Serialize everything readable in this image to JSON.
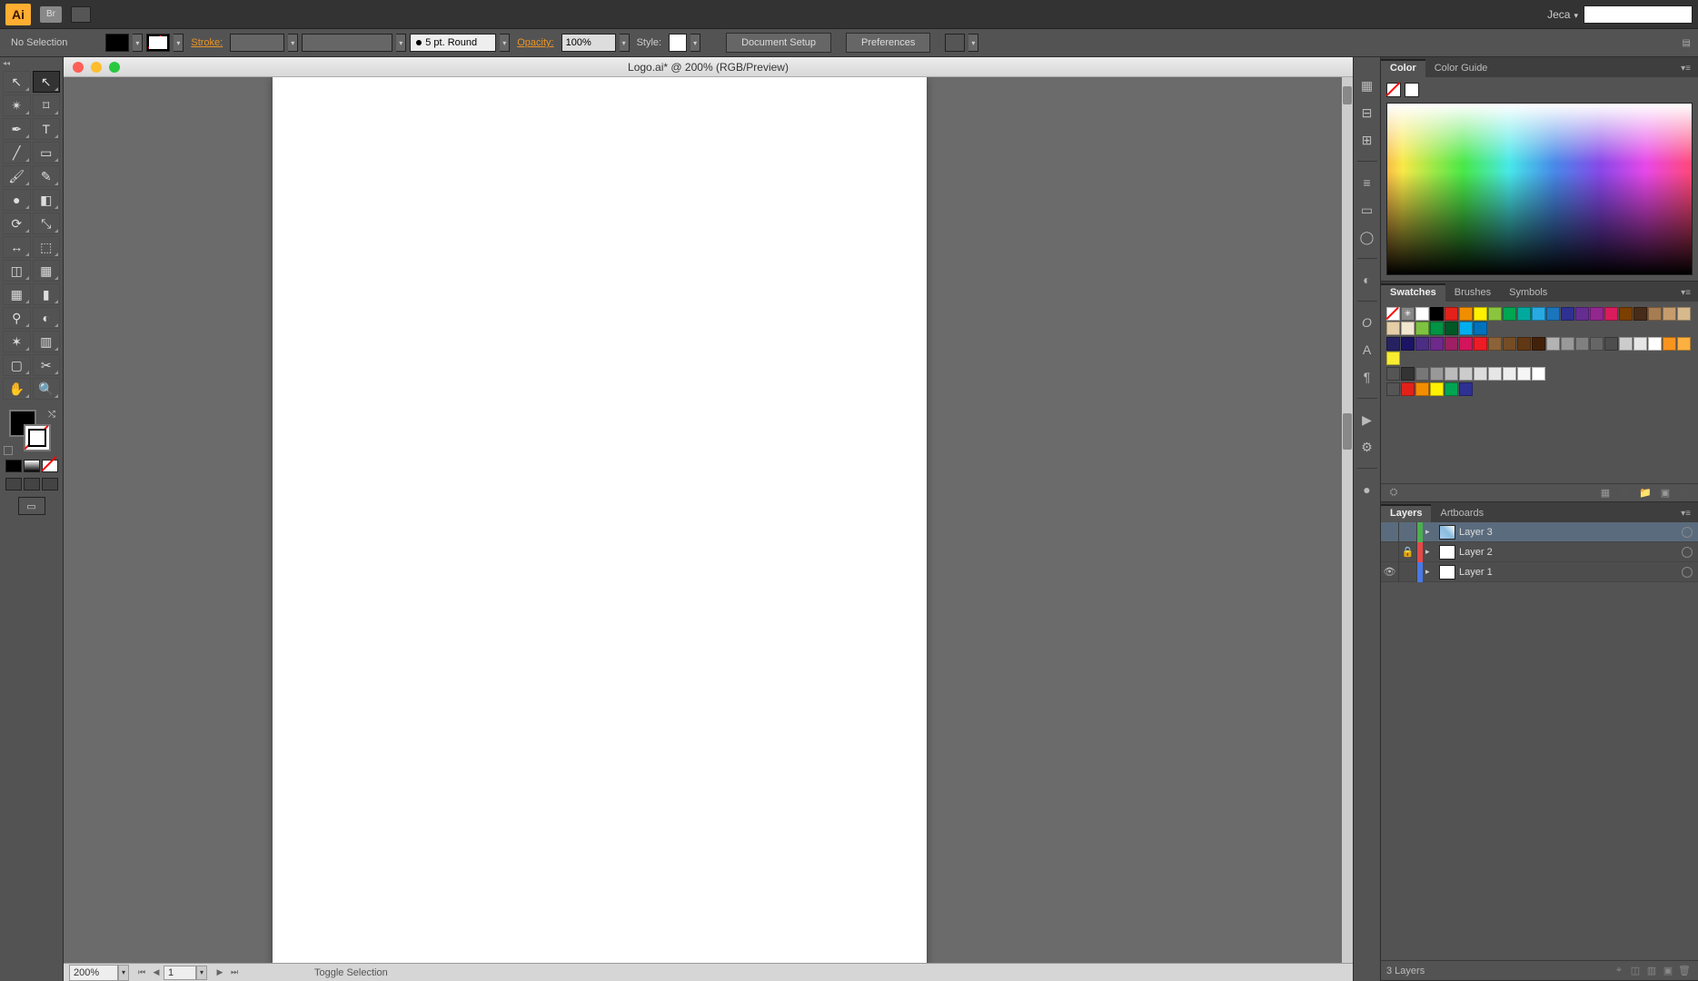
{
  "appbar": {
    "logo": "Ai",
    "bridge": "Br",
    "user": "Jeca"
  },
  "controlbar": {
    "selection": "No Selection",
    "stroke_label": "Stroke:",
    "brush_text": "5 pt. Round",
    "opacity_label": "Opacity:",
    "opacity_value": "100%",
    "style_label": "Style:",
    "doc_setup": "Document Setup",
    "preferences": "Preferences"
  },
  "document": {
    "title": "Logo.ai* @ 200% (RGB/Preview)"
  },
  "panels": {
    "color": {
      "tab1": "Color",
      "tab2": "Color Guide"
    },
    "swatches": {
      "tab1": "Swatches",
      "tab2": "Brushes",
      "tab3": "Symbols"
    },
    "layers": {
      "tab1": "Layers",
      "tab2": "Artboards",
      "items": [
        {
          "name": "Layer 3",
          "color": "green",
          "selected": true,
          "visible": false,
          "locked": false,
          "thumb": "img"
        },
        {
          "name": "Layer 2",
          "color": "red",
          "selected": false,
          "visible": false,
          "locked": true,
          "thumb": "white"
        },
        {
          "name": "Layer 1",
          "color": "blue",
          "selected": false,
          "visible": true,
          "locked": false,
          "thumb": "white"
        }
      ],
      "footer_count": "3 Layers"
    }
  },
  "swatch_colors": {
    "row1": [
      "#ffffff",
      "#000000",
      "#e32119",
      "#f18e00",
      "#fff100",
      "#8bc53f",
      "#00a651",
      "#00a99d",
      "#27aae1",
      "#1b75bc",
      "#2e3192",
      "#662d91",
      "#92278f",
      "#d91b5b",
      "#7b3f00",
      "#472c19",
      "#a67c52",
      "#c69c6d",
      "#d7b98e",
      "#e4cda7",
      "#f2e7cf",
      "#7fc241",
      "#009444",
      "#005826",
      "#00aeef",
      "#0072bc"
    ],
    "row2": [
      "#262262",
      "#1b1464",
      "#4b2e83",
      "#6e298d",
      "#9e1f63",
      "#d4145a",
      "#ed1c24",
      "#8c6239",
      "#754c24",
      "#603813",
      "#42210b",
      "#b3b3b3",
      "#999999",
      "#808080",
      "#666666",
      "#4d4d4d",
      "#cccccc",
      "#e6e6e6",
      "#ffffff",
      "#f7941d",
      "#fcb040",
      "#f9ed32"
    ],
    "row3": [
      "#333333",
      "#777777",
      "#999999",
      "#bbbbbb",
      "#cccccc",
      "#dddddd",
      "#e6e6e6",
      "#eeeeee",
      "#f5f5f5",
      "#ffffff"
    ],
    "row4": [
      "#e32119",
      "#f18e00",
      "#fff100",
      "#00a651",
      "#2e3192"
    ]
  },
  "statusbar": {
    "zoom": "200%",
    "artboard": "1",
    "tool_hint": "Toggle Selection"
  }
}
